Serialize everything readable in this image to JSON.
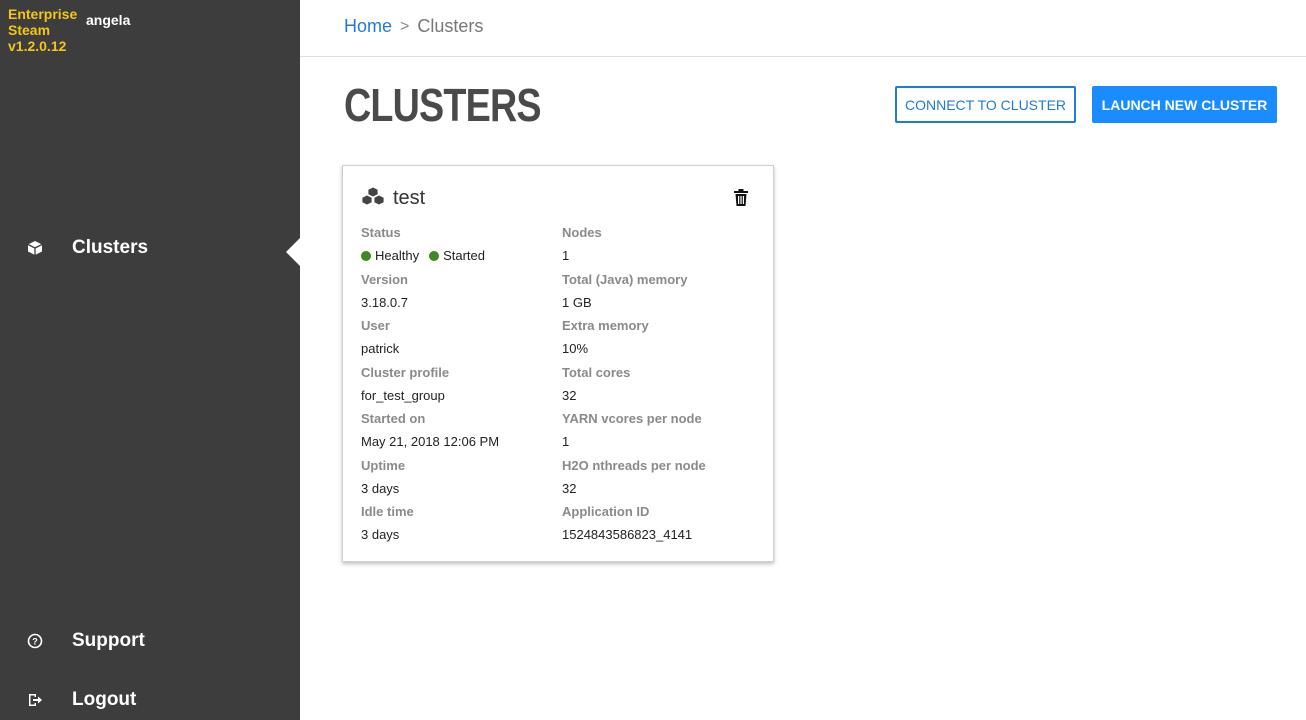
{
  "sidebar": {
    "brand_line1": "Enterprise",
    "brand_line2": "Steam",
    "brand_line3": "v1.2.0.12",
    "username": "angela",
    "items": [
      {
        "label": "Clusters",
        "icon": "cube-icon"
      },
      {
        "label": "Support",
        "icon": "help-circle-icon"
      },
      {
        "label": "Logout",
        "icon": "logout-icon"
      }
    ]
  },
  "breadcrumb": {
    "home": "Home",
    "separator": ">",
    "current": "Clusters"
  },
  "page": {
    "title": "CLUSTERS",
    "connect_button": "CONNECT TO CLUSTER",
    "launch_button": "LAUNCH NEW CLUSTER"
  },
  "cluster": {
    "name": "test",
    "left_fields": [
      {
        "key": "Status",
        "value": ""
      },
      {
        "key": "Version",
        "value": "3.18.0.7"
      },
      {
        "key": "User",
        "value": "patrick"
      },
      {
        "key": "Cluster profile",
        "value": "for_test_group"
      },
      {
        "key": "Started on",
        "value": "May 21, 2018 12:06 PM"
      },
      {
        "key": "Uptime",
        "value": "3 days"
      },
      {
        "key": "Idle time",
        "value": "3 days"
      }
    ],
    "status": {
      "health": "Healthy",
      "state": "Started",
      "color": "#3e8a1f"
    },
    "right_fields": [
      {
        "key": "Nodes",
        "value": "1"
      },
      {
        "key": "Total (Java) memory",
        "value": "1 GB"
      },
      {
        "key": "Extra memory",
        "value": "10%"
      },
      {
        "key": "Total cores",
        "value": "32"
      },
      {
        "key": "YARN vcores per node",
        "value": "1"
      },
      {
        "key": "H2O nthreads per node",
        "value": "32"
      },
      {
        "key": "Application ID",
        "value": "1524843586823_4141"
      }
    ]
  },
  "colors": {
    "sidebar_bg": "#3d3d3d",
    "brand": "#f5c518",
    "accent": "#1a8cff"
  }
}
